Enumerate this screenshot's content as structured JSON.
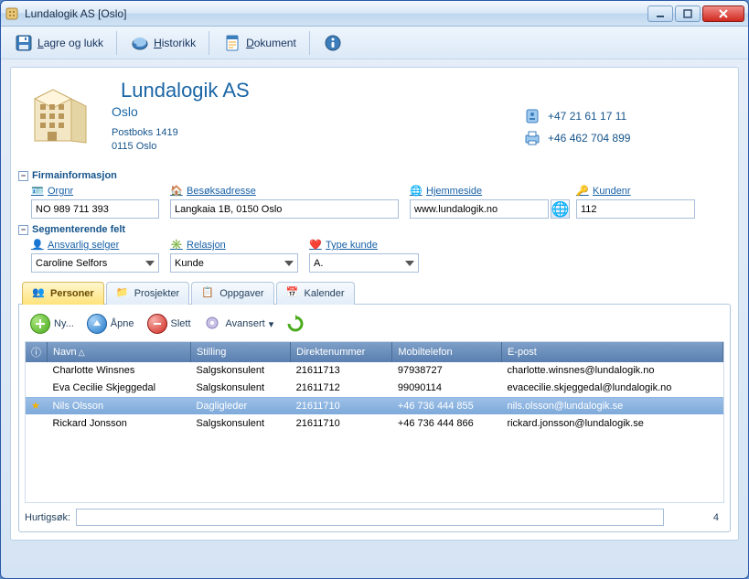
{
  "window": {
    "title": "Lundalogik AS [Oslo]"
  },
  "toolbar": {
    "save": "Lagre og lukk",
    "history": "Historikk",
    "document": "Dokument"
  },
  "company": {
    "name": "Lundalogik AS",
    "city": "Oslo",
    "addr1": "Postboks 1419",
    "addr2": "0115 Oslo",
    "phone": "+47 21 61 17 11",
    "fax": "+46 462 704 899"
  },
  "sections": {
    "firmainfo": {
      "title": "Firmainformasjon",
      "orgnr_label": "Orgnr",
      "orgnr": "NO 989 711 393",
      "besok_label": "Besøksadresse",
      "besok": "Langkaia 1B, 0150 Oslo",
      "hjemmeside_label": "Hjemmeside",
      "hjemmeside": "www.lundalogik.no",
      "kundenr_label": "Kundenr",
      "kundenr": "112"
    },
    "segment": {
      "title": "Segmenterende felt",
      "selger_label": "Ansvarlig selger",
      "selger": "Caroline Selfors",
      "relasjon_label": "Relasjon",
      "relasjon": "Kunde",
      "typekunde_label": "Type kunde",
      "typekunde": "A."
    }
  },
  "tabs": {
    "personer": "Personer",
    "prosjekter": "Prosjekter",
    "oppgaver": "Oppgaver",
    "kalender": "Kalender"
  },
  "subtoolbar": {
    "ny": "Ny...",
    "apne": "Åpne",
    "slett": "Slett",
    "avansert": "Avansert"
  },
  "grid": {
    "headers": {
      "navn": "Navn",
      "stilling": "Stilling",
      "direkte": "Direktenummer",
      "mobil": "Mobiltelefon",
      "epost": "E-post"
    },
    "rows": [
      {
        "star": false,
        "navn": "Charlotte Winsnes",
        "stilling": "Salgskonsulent",
        "direkte": "21611713",
        "mobil": "97938727",
        "epost": "charlotte.winsnes@lundalogik.no",
        "selected": false
      },
      {
        "star": false,
        "navn": "Eva Cecilie Skjeggedal",
        "stilling": "Salgskonsulent",
        "direkte": "21611712",
        "mobil": "99090114",
        "epost": "evacecilie.skjeggedal@lundalogik.no",
        "selected": false
      },
      {
        "star": true,
        "navn": "Nils Olsson",
        "stilling": "Dagligleder",
        "direkte": "21611710",
        "mobil": "+46 736 444 855",
        "epost": "nils.olsson@lundalogik.se",
        "selected": true
      },
      {
        "star": false,
        "navn": "Rickard Jonsson",
        "stilling": "Salgskonsulent",
        "direkte": "21611710",
        "mobil": "+46 736 444 866",
        "epost": "rickard.jonsson@lundalogik.se",
        "selected": false
      }
    ]
  },
  "footer": {
    "label": "Hurtigsøk:",
    "count": "4"
  }
}
